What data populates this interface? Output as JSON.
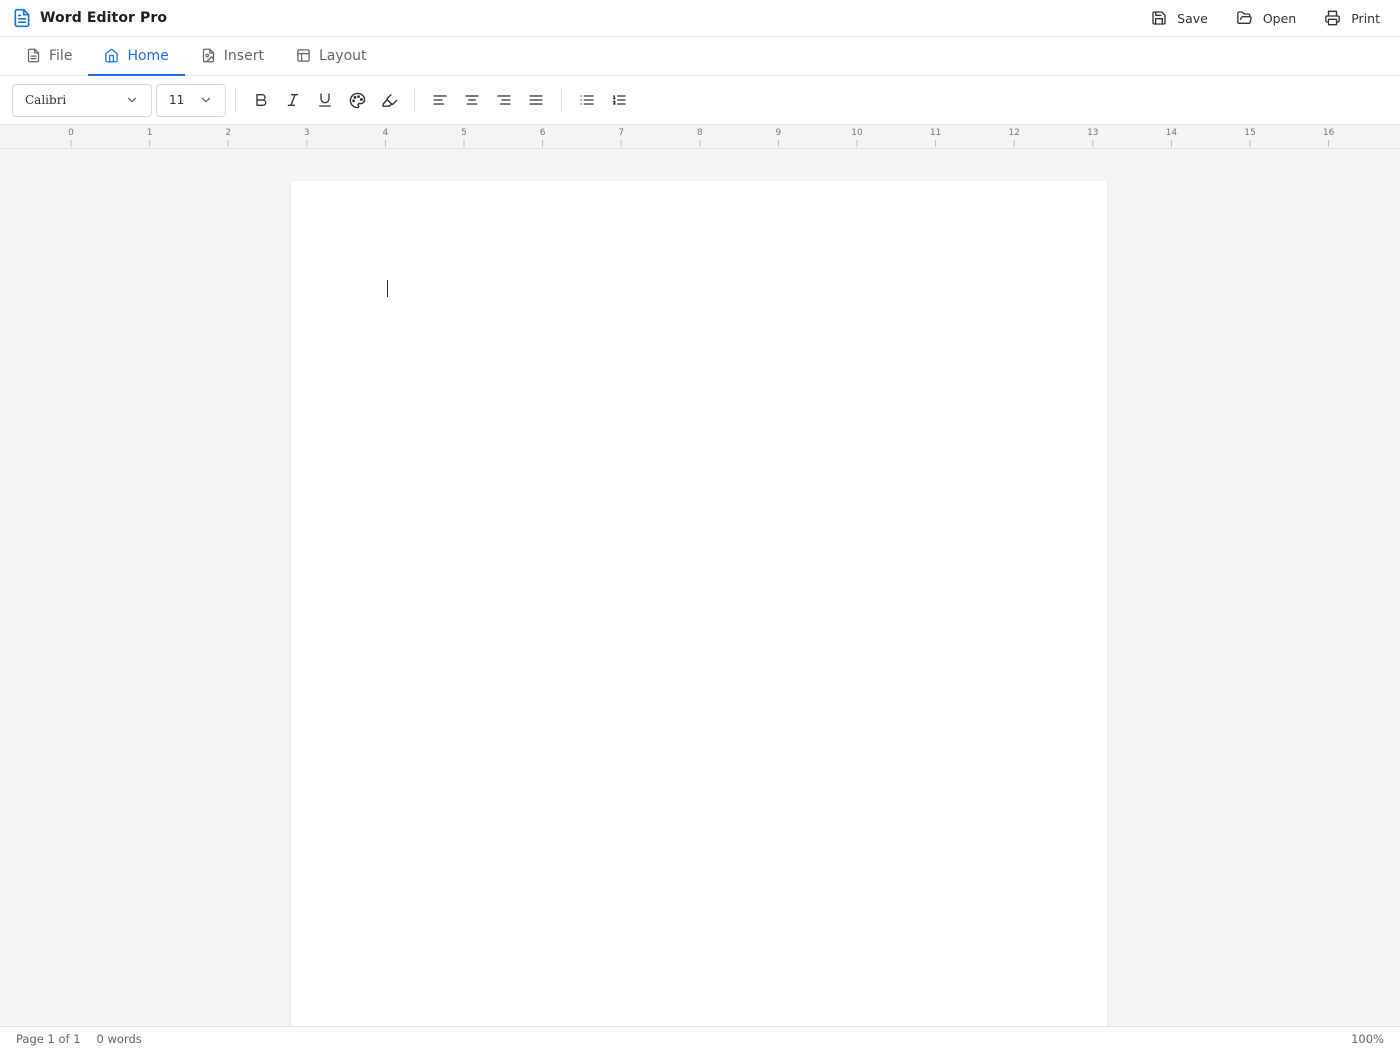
{
  "app": {
    "title": "Word Editor Pro",
    "accent_color": "#1a73e8"
  },
  "title_actions": {
    "save": {
      "label": "Save",
      "icon": "save-icon"
    },
    "open": {
      "label": "Open",
      "icon": "folder-open-icon"
    },
    "print": {
      "label": "Print",
      "icon": "printer-icon"
    }
  },
  "tabs": [
    {
      "label": "File",
      "icon": "file-icon",
      "active": false
    },
    {
      "label": "Home",
      "icon": "home-icon",
      "active": true
    },
    {
      "label": "Insert",
      "icon": "image-icon",
      "active": false
    },
    {
      "label": "Layout",
      "icon": "layout-icon",
      "active": false
    }
  ],
  "toolbar": {
    "font_family": "Calibri",
    "font_size": "11"
  },
  "ruler": {
    "marks": [
      "0",
      "1",
      "2",
      "3",
      "4",
      "5",
      "6",
      "7",
      "8",
      "9",
      "10",
      "11",
      "12",
      "13",
      "14",
      "15",
      "16"
    ]
  },
  "status": {
    "page": "Page 1 of 1",
    "words": "0 words",
    "zoom": "100%"
  }
}
